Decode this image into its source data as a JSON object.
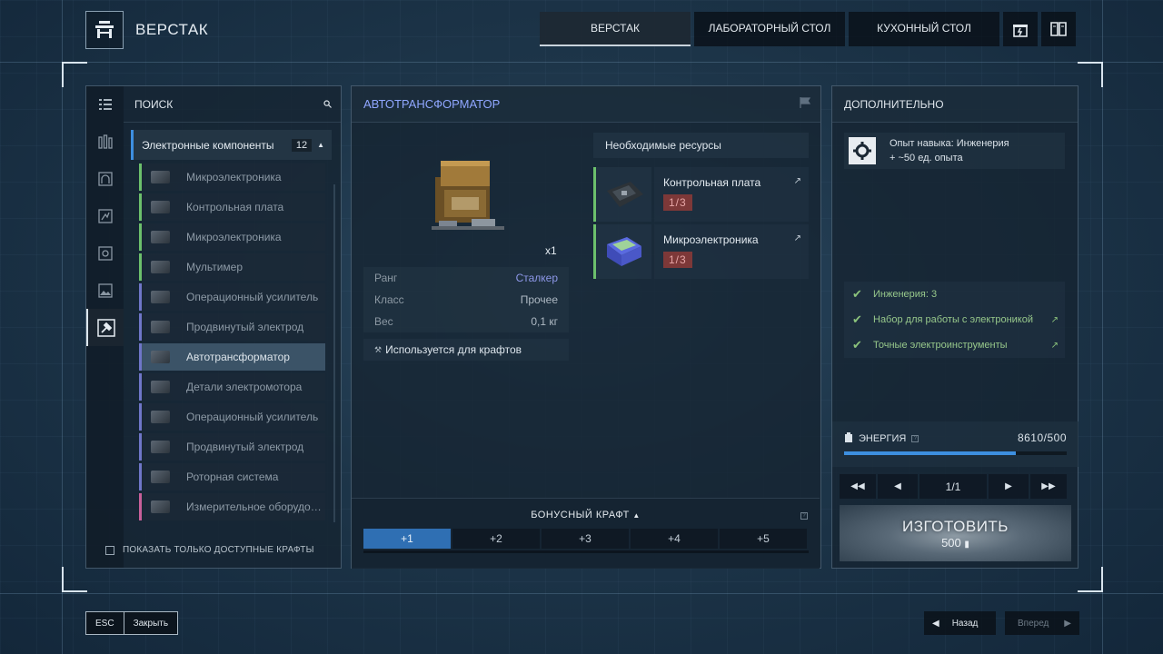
{
  "header": {
    "title": "ВЕРСТАК",
    "tabs": [
      {
        "label": "ВЕРСТАК",
        "active": true
      },
      {
        "label": "ЛАБОРАТОРНЫЙ СТОЛ",
        "active": false
      },
      {
        "label": "КУХОННЫЙ СТОЛ",
        "active": false
      }
    ],
    "icons": [
      "gift-icon",
      "book-icon"
    ]
  },
  "left": {
    "search_label": "ПОИСК",
    "rail_icons": [
      "list-icon",
      "tools-icon",
      "helmet-icon",
      "burst-icon",
      "box-icon",
      "image-icon",
      "hammer-icon"
    ],
    "category": {
      "label": "Электронные компоненты",
      "count": "12"
    },
    "items": [
      {
        "label": "Микроэлектроника",
        "color": "green"
      },
      {
        "label": "Контрольная плата",
        "color": "green"
      },
      {
        "label": "Микроэлектроника",
        "color": "green"
      },
      {
        "label": "Мультимер",
        "color": "green"
      },
      {
        "label": "Операционный усилитель",
        "color": "purple"
      },
      {
        "label": "Продвинутый электрод",
        "color": "purple"
      },
      {
        "label": "Автотрансформатор",
        "color": "purple",
        "selected": true
      },
      {
        "label": "Детали электромотора",
        "color": "purple"
      },
      {
        "label": "Операционный усилитель",
        "color": "purple"
      },
      {
        "label": "Продвинутый электрод",
        "color": "purple"
      },
      {
        "label": "Роторная система",
        "color": "purple"
      },
      {
        "label": "Измерительное оборудован..",
        "color": "pink"
      }
    ],
    "only_available_label": "ПОКАЗАТЬ ТОЛЬКО ДОСТУПНЫЕ КРАФТЫ"
  },
  "center": {
    "title": "АВТОТРАНСФОРМАТОР",
    "quantity": "x1",
    "stats": [
      {
        "key": "Ранг",
        "value": "Сталкер",
        "accent": true
      },
      {
        "key": "Класс",
        "value": "Прочее"
      },
      {
        "key": "Вес",
        "value": "0,1 кг"
      }
    ],
    "used_for": "Используется для крафтов",
    "resources_title": "Необходимые ресурсы",
    "resources": [
      {
        "name": "Контрольная плата",
        "count": "1/3"
      },
      {
        "name": "Микроэлектроника",
        "count": "1/3"
      }
    ],
    "bonus_title": "БОНУСНЫЙ КРАФТ",
    "bonus_help": "?",
    "bonus_options": [
      "+1",
      "+2",
      "+3",
      "+4",
      "+5"
    ]
  },
  "right": {
    "title": "ДОПОЛНИТЕЛЬНО",
    "xp_line1": "Опыт навыка: Инженерия",
    "xp_line2": "+ ~50 ед. опыта",
    "requirements": [
      {
        "label": "Инженерия: 3",
        "link": false
      },
      {
        "label": "Набор для работы с электроникой",
        "link": true
      },
      {
        "label": "Точные электроинструменты",
        "link": true
      }
    ],
    "energy_label": "ЭНЕРГИЯ",
    "energy_help": "?",
    "energy_value": "8610/500",
    "energy_fill": 0.77,
    "pager": "1/1",
    "craft_label": "ИЗГОТОВИТЬ",
    "craft_cost": "500"
  },
  "footer": {
    "esc_key": "ESC",
    "esc_label": "Закрыть",
    "back_label": "Назад",
    "forward_label": "Вперед"
  }
}
